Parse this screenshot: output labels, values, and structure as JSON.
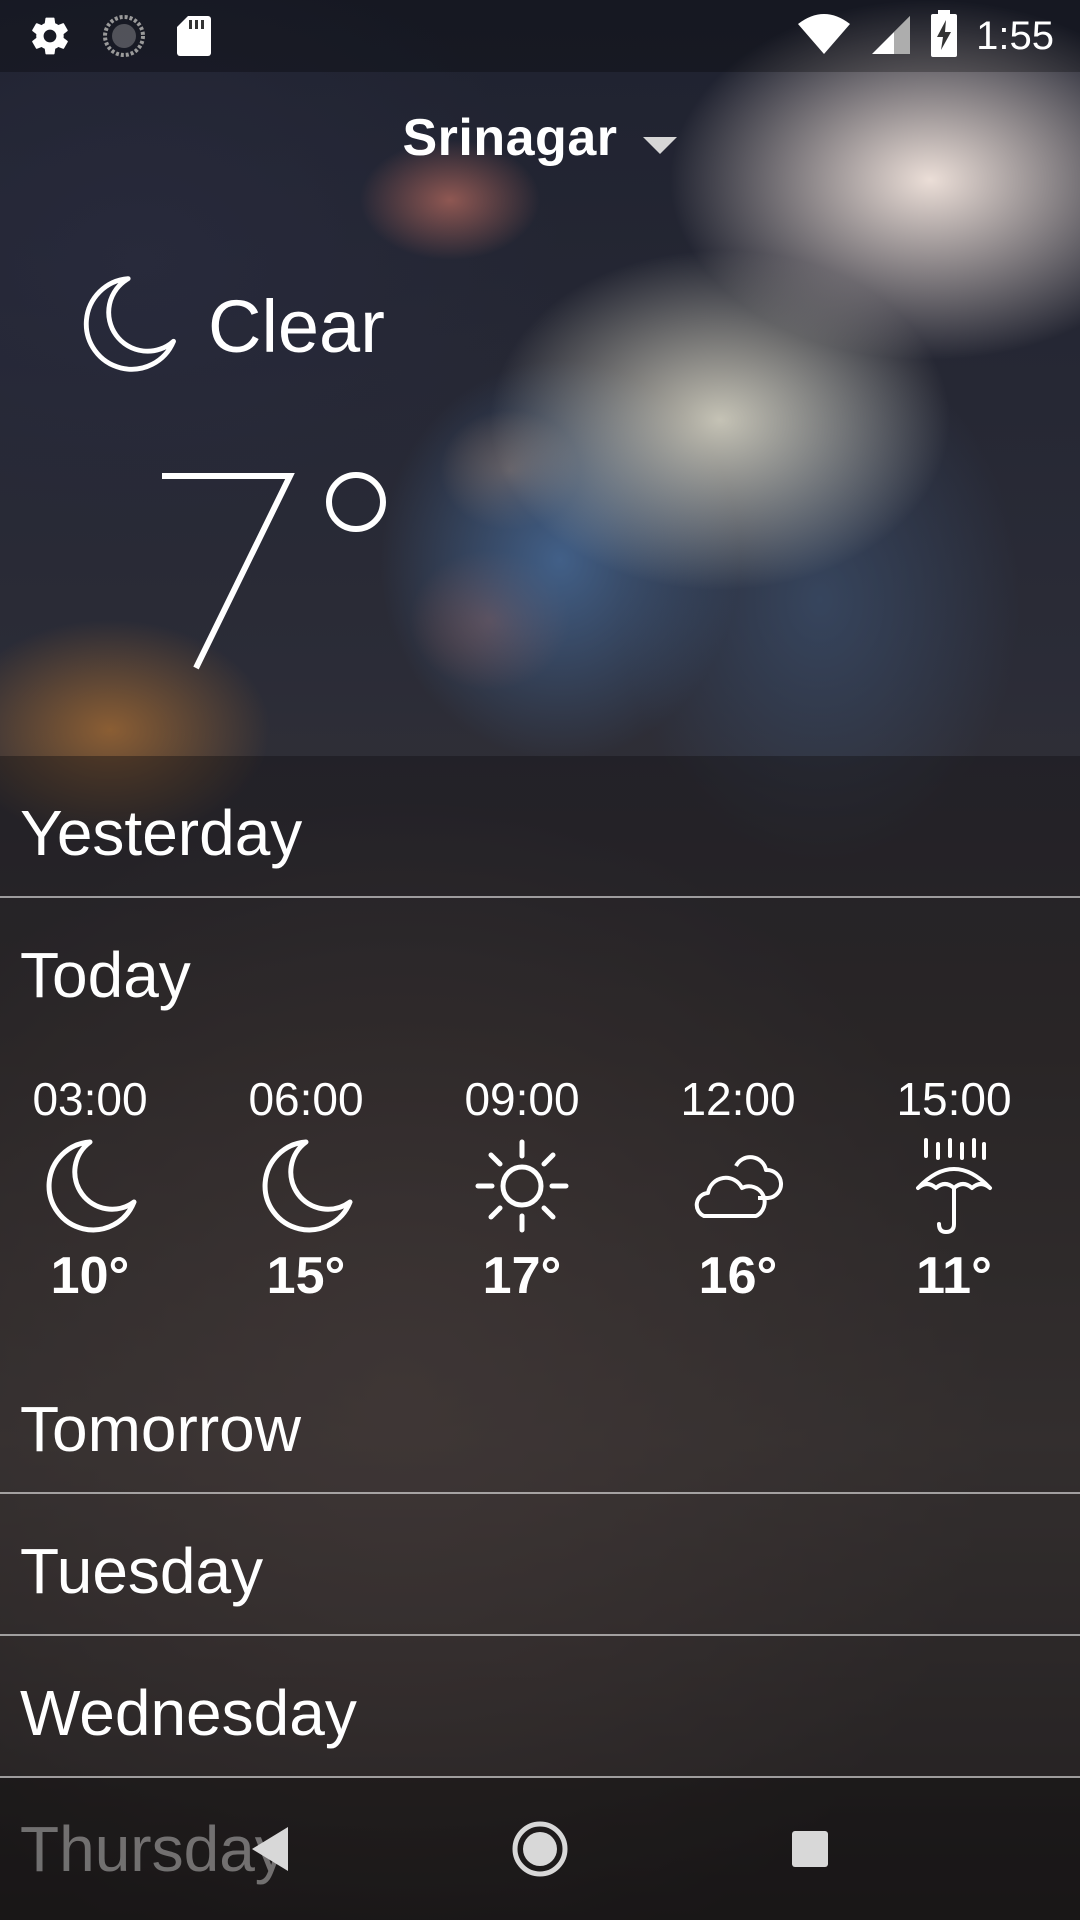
{
  "status_bar": {
    "time": "1:55",
    "left_icons": [
      "settings-icon",
      "sync-icon",
      "sd-card-icon"
    ],
    "right_icons": [
      "wifi-icon",
      "cellular-signal-icon",
      "battery-charging-icon"
    ]
  },
  "header": {
    "city": "Srinagar",
    "condition": "Clear",
    "condition_icon": "moon-icon",
    "temperature": "7°"
  },
  "days": {
    "yesterday": "Yesterday",
    "today": "Today",
    "tomorrow": "Tomorrow",
    "tuesday": "Tuesday",
    "wednesday": "Wednesday",
    "thursday": "Thursday"
  },
  "today_hourly": [
    {
      "time": "03:00",
      "icon": "moon-icon",
      "temp": "10°"
    },
    {
      "time": "06:00",
      "icon": "moon-icon",
      "temp": "15°"
    },
    {
      "time": "09:00",
      "icon": "sun-icon",
      "temp": "17°"
    },
    {
      "time": "12:00",
      "icon": "cloudy-icon",
      "temp": "16°"
    },
    {
      "time": "15:00",
      "icon": "rain-umbrella-icon",
      "temp": "11°"
    }
  ],
  "nav_bar": {
    "buttons": [
      "back-icon",
      "home-icon",
      "recents-icon"
    ]
  }
}
